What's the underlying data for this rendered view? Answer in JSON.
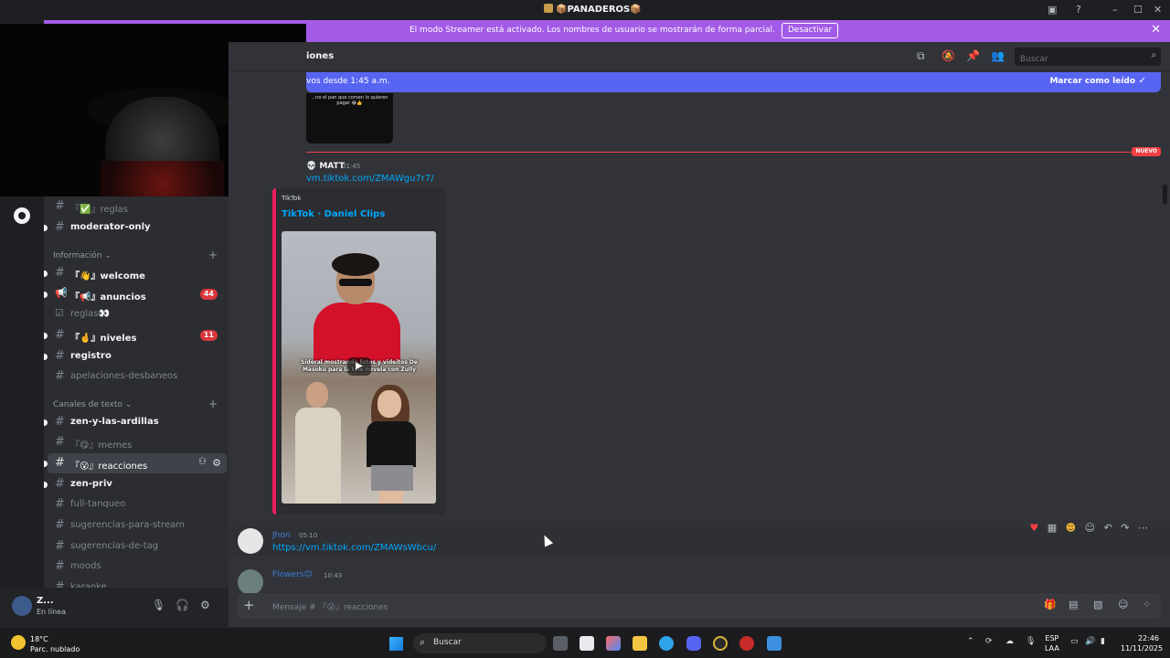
{
  "window": {
    "title": "📦PANADEROS📦"
  },
  "streamer_banner": {
    "message": "El modo Streamer está activado. Los nombres de usuario se mostrarán de forma parcial.",
    "button": "Desactivar",
    "close": "✕"
  },
  "channels": {
    "items": [
      {
        "name": "『✅』reglas",
        "unread": false,
        "hash": "#"
      },
      {
        "name": "moderator-only",
        "unread": true,
        "hash": "#"
      }
    ],
    "category_info": "Información ⌄",
    "info_items": [
      {
        "name": "『👋』welcome",
        "unread": true,
        "hash": "#"
      },
      {
        "name": "『📢』anuncios",
        "unread": true,
        "hash": "📢",
        "badge": "44"
      },
      {
        "name": "reglas👀",
        "unread": false,
        "hash": "☑"
      },
      {
        "name": "『🤞』niveles",
        "unread": true,
        "hash": "#",
        "badge": "11"
      },
      {
        "name": "registro",
        "unread": true,
        "hash": "#"
      },
      {
        "name": "apelaciones-desbaneos",
        "unread": false,
        "hash": "#"
      }
    ],
    "category_text": "Canales de texto ⌄",
    "text_items": [
      {
        "name": "zen-y-las-ardillas",
        "unread": true,
        "hash": "#"
      },
      {
        "name": "『😋』memes",
        "unread": false,
        "hash": "#"
      },
      {
        "name": "『😮』reacciones",
        "unread": false,
        "hash": "#",
        "active": true
      },
      {
        "name": "zen-priv",
        "unread": true,
        "hash": "#"
      },
      {
        "name": "full-tanqueo",
        "unread": false,
        "hash": "#"
      },
      {
        "name": "sugerencias-para-stream",
        "unread": false,
        "hash": "#"
      },
      {
        "name": "sugerencias-de-tag",
        "unread": false,
        "hash": "#"
      },
      {
        "name": "moods",
        "unread": false,
        "hash": "#"
      },
      {
        "name": "karaoke",
        "unread": false,
        "hash": "#"
      }
    ]
  },
  "user": {
    "name": "Z...",
    "status": "En línea"
  },
  "header": {
    "channel": "iones",
    "search_placeholder": "Buscar"
  },
  "new_bar": {
    "text": "vos desde 1:45 a.m.",
    "mark": "Marcar como leído"
  },
  "prev_thumb_text": "...no el pan que comen lo quieren pagar 😂👍",
  "divider": {
    "label": "NUEVO"
  },
  "msg1": {
    "author": "💀 MATT",
    "time": "01:45",
    "link": "vm.tiktok.com/ZMAWgu7r7/",
    "embed": {
      "provider": "TikTok",
      "title": "TikTok · Daniel Clips",
      "caption": "Sideral mostrando fotos y videitos De Masoku para la tele novela con Zully"
    }
  },
  "msg2": {
    "author": "Jhon",
    "time": "05:10",
    "link": "https://vm.tiktok.com/ZMAWsWbcu/"
  },
  "msg3": {
    "author": "Flowers😊",
    "time": "10:43"
  },
  "composer": {
    "placeholder": "Mensaje # 『😮』reacciones"
  },
  "taskbar": {
    "temp": "18°C",
    "weather": "Parc. nublado",
    "search": "Buscar",
    "lang1": "ESP",
    "lang2": "LAA",
    "time": "22:46",
    "date": "11/11/2025"
  },
  "colors": {
    "accent": "#5865f2",
    "streamer": "#a35be7",
    "new": "#f23f43",
    "link": "#00a8fc",
    "embed_border": "#ec1f5d"
  }
}
